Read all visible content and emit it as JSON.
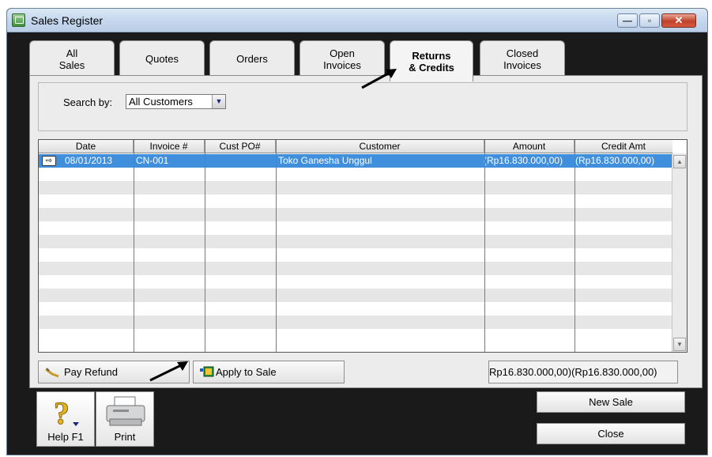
{
  "window": {
    "title": "Sales Register",
    "minimize_glyph": "—",
    "maximize_glyph": "▫",
    "close_glyph": "✕"
  },
  "tabs": [
    {
      "label": "All\nSales",
      "active": false
    },
    {
      "label": "Quotes",
      "active": false
    },
    {
      "label": "Orders",
      "active": false
    },
    {
      "label": "Open\nInvoices",
      "active": false
    },
    {
      "label": "Returns\n& Credits",
      "active": true
    },
    {
      "label": "Closed\nInvoices",
      "active": false
    }
  ],
  "search": {
    "label": "Search by:",
    "selected": "All Customers"
  },
  "grid": {
    "columns": [
      "Date",
      "Invoice #",
      "Cust PO#",
      "Customer",
      "Amount",
      "Credit Amt"
    ],
    "rows": [
      {
        "date": "08/01/2013",
        "invoice": "CN-001",
        "cust_po": "",
        "customer": "Toko Ganesha Unggul",
        "amount": "(Rp16.830.000,00)",
        "credit_amt": "(Rp16.830.000,00)"
      }
    ]
  },
  "buttons": {
    "pay_refund": "Pay Refund",
    "apply_to_sale": "Apply to Sale",
    "help": "Help F1",
    "print": "Print",
    "new_sale": "New Sale",
    "close": "Close"
  },
  "totals": {
    "amount": "Rp16.830.000,00)",
    "credit_amt": "(Rp16.830.000,00)"
  },
  "icons": {
    "help": "question-mark-icon",
    "print": "printer-icon",
    "pay_refund": "refund-pen-icon",
    "apply_to_sale": "apply-sale-icon",
    "row_zoom": "zoom-arrow-icon"
  }
}
